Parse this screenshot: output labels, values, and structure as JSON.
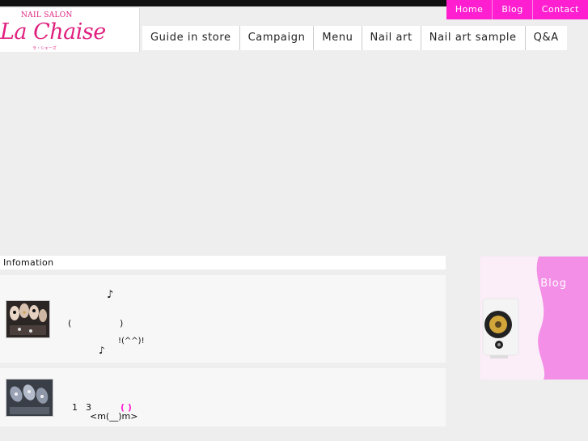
{
  "topnav": {
    "items": [
      "Home",
      "Blog",
      "Contact"
    ]
  },
  "logo": {
    "small": "NAIL SALON",
    "big": "La Chaise",
    "tiny": "ラ・シェーズ"
  },
  "mainnav": {
    "items": [
      "Guide in store",
      "Campaign",
      "Menu",
      "Nail art",
      "Nail art sample",
      "Q&A"
    ]
  },
  "info": {
    "header": "Infomation"
  },
  "entries": [
    {
      "lines": [
        "♪",
        "(",
        ")",
        "!(^^)!",
        "♪"
      ]
    },
    {
      "lines": [
        "1",
        "3",
        "( )",
        "<m(__)m>"
      ]
    }
  ],
  "blog_banner": {
    "label": "Blog"
  },
  "colors": {
    "accent": "#ff1fd0",
    "logo": "#e0207f",
    "background": "#eeeeee"
  }
}
